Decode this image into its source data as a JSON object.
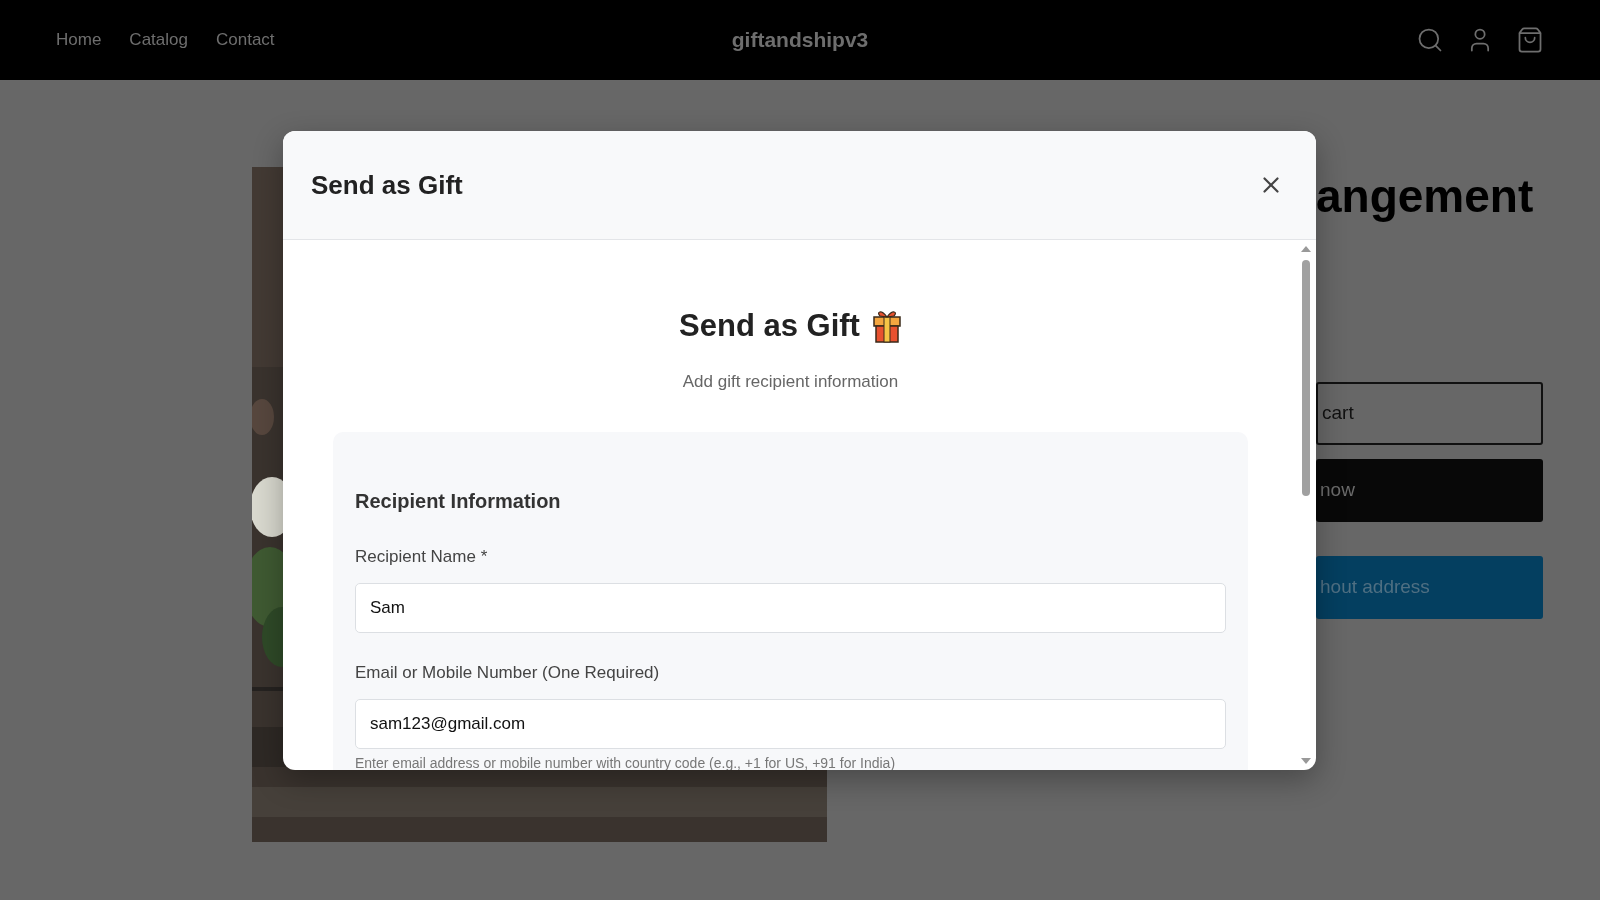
{
  "nav": {
    "links": [
      "Home",
      "Catalog",
      "Contact"
    ],
    "logo": "giftandshipv3"
  },
  "product": {
    "title": "angement",
    "buttons": [
      {
        "label": "cart",
        "kind": "outline"
      },
      {
        "label": "now",
        "kind": "solid"
      },
      {
        "label": "hout address",
        "kind": "accent"
      }
    ]
  },
  "modal": {
    "title": "Send as Gift",
    "heading": "Send as Gift",
    "subtitle": "Add gift recipient information",
    "section": {
      "title": "Recipient Information",
      "fields": [
        {
          "label": "Recipient Name *",
          "value": "Sam"
        },
        {
          "label": "Email or Mobile Number (One Required)",
          "value": "sam123@gmail.com",
          "hint": "Enter email address or mobile number with country code (e.g., +1 for US, +91 for India)"
        }
      ]
    }
  }
}
